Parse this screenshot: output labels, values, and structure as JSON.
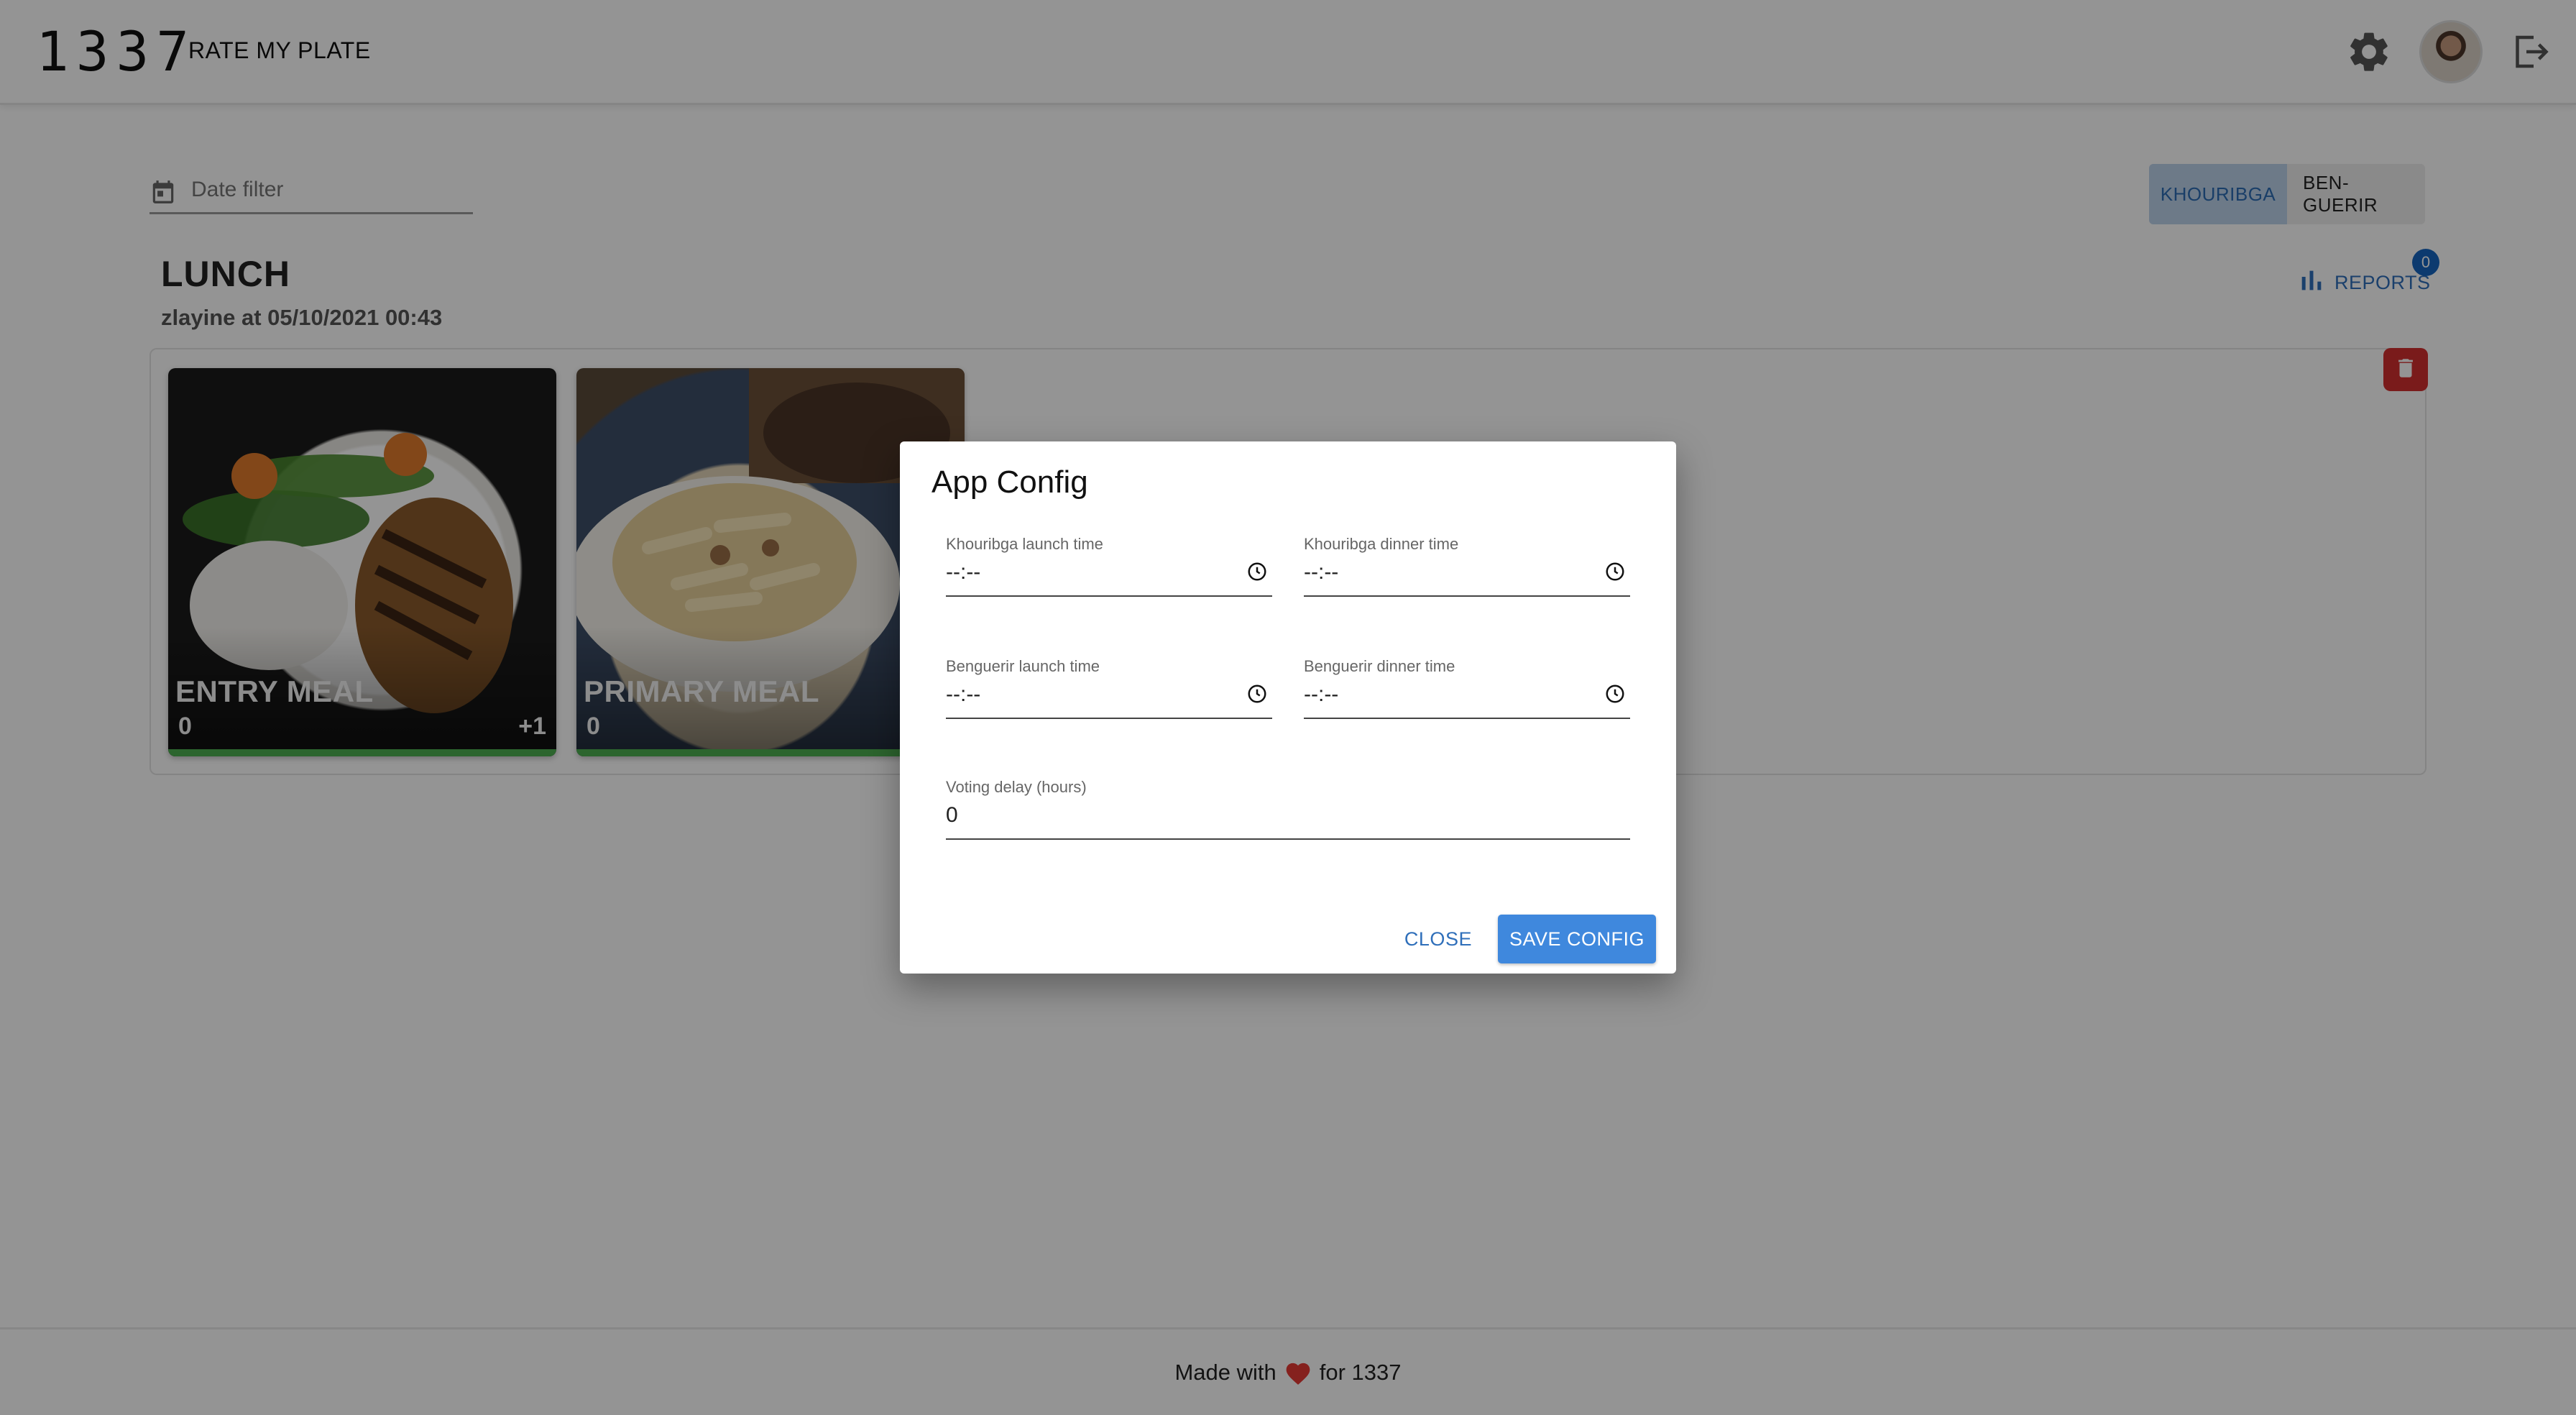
{
  "header": {
    "logo_text": "1337",
    "app_name": "RATE MY PLATE",
    "icons": {
      "settings": "gear-icon",
      "avatar": "user-avatar",
      "logout": "logout-icon"
    }
  },
  "filters": {
    "date_placeholder": "Date filter",
    "campus_options": [
      "KHOURIBGA",
      "BEN-GUERIR"
    ],
    "selected_campus": "KHOURIBGA"
  },
  "meal_section": {
    "title": "LUNCH",
    "subtitle": "zlayine at 05/10/2021 00:43",
    "reports_label": "REPORTS",
    "reports_count": "0",
    "meals": [
      {
        "name": "ENTRY MEAL",
        "score": "0",
        "delta": "+1"
      },
      {
        "name": "PRIMARY MEAL",
        "score": "0"
      }
    ]
  },
  "dialog": {
    "title": "App Config",
    "fields": {
      "khouribga_launch": {
        "label": "Khouribga launch time",
        "value": "--:--"
      },
      "khouribga_dinner": {
        "label": "Khouribga dinner time",
        "value": "--:--"
      },
      "benguerir_launch": {
        "label": "Benguerir launch time",
        "value": "--:--"
      },
      "benguerir_dinner": {
        "label": "Benguerir dinner time",
        "value": "--:--"
      },
      "voting_delay": {
        "label": "Voting delay (hours)",
        "value": "0"
      }
    },
    "close_label": "CLOSE",
    "save_label": "SAVE CONFIG"
  },
  "footer": {
    "before": "Made with",
    "after": "for 1337"
  },
  "colors": {
    "primary": "#3f88dd",
    "delete": "#d32f2f",
    "rating_bar": "#4caf50",
    "heart": "#e53935"
  }
}
